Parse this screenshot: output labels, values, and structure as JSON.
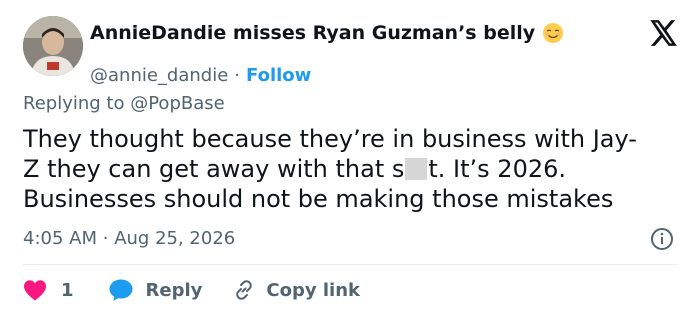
{
  "author": {
    "display_name": "AnnieDandie misses Ryan Guzman’s belly",
    "emoji_icon": "relieved-face-emoji",
    "handle": "@annie_dandie",
    "separator": "·",
    "follow_label": "Follow"
  },
  "platform_logo": "x-logo-icon",
  "reply_context": {
    "prefix": "Replying to",
    "mention": "@PopBase"
  },
  "tweet": {
    "lines": [
      "They thought because they’re in business with Jay-",
      "Z they can get away with that s",
      "t. It’s 2026.",
      "Businesses should not be making those mistakes"
    ]
  },
  "meta": {
    "time": "4:05 AM",
    "separator": "·",
    "date": "Aug 25, 2026"
  },
  "actions": {
    "like_count": "1",
    "reply_label": "Reply",
    "copy_label": "Copy link"
  },
  "colors": {
    "accent": "#1d9bf0",
    "like_red": "#f91880",
    "secondary_text": "#536471",
    "primary_text": "#0f1419"
  }
}
